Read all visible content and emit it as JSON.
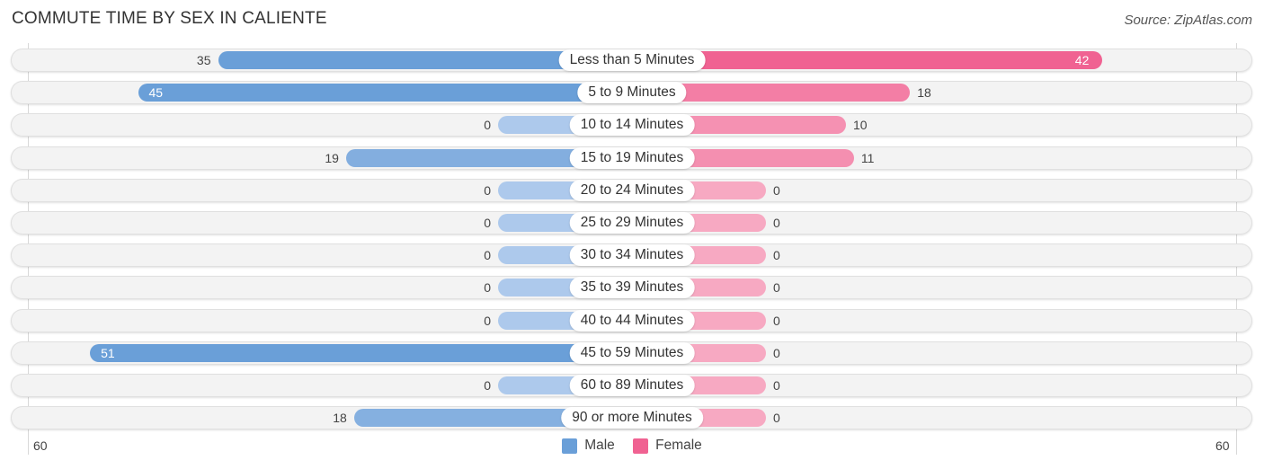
{
  "title": "COMMUTE TIME BY SEX IN CALIENTE",
  "source": "Source: ZipAtlas.com",
  "colors": {
    "male": "#6a9fd8",
    "male_light": "#adc9ec",
    "female": "#f06292",
    "female_light": "#f7a9c2"
  },
  "chart_data": {
    "type": "bar",
    "orientation": "horizontal-diverging",
    "title": "COMMUTE TIME BY SEX IN CALIENTE",
    "categories": [
      "Less than 5 Minutes",
      "5 to 9 Minutes",
      "10 to 14 Minutes",
      "15 to 19 Minutes",
      "20 to 24 Minutes",
      "25 to 29 Minutes",
      "30 to 34 Minutes",
      "35 to 39 Minutes",
      "40 to 44 Minutes",
      "45 to 59 Minutes",
      "60 to 89 Minutes",
      "90 or more Minutes"
    ],
    "series": [
      {
        "name": "Male",
        "values": [
          35,
          45,
          0,
          19,
          0,
          0,
          0,
          0,
          0,
          51,
          0,
          18
        ]
      },
      {
        "name": "Female",
        "values": [
          42,
          18,
          10,
          11,
          0,
          0,
          0,
          0,
          0,
          0,
          0,
          0
        ]
      }
    ],
    "xlim": [
      60,
      60
    ],
    "axis_ticks": {
      "left": "60",
      "right": "60"
    },
    "legend": {
      "position": "bottom-center",
      "entries": [
        "Male",
        "Female"
      ]
    }
  }
}
